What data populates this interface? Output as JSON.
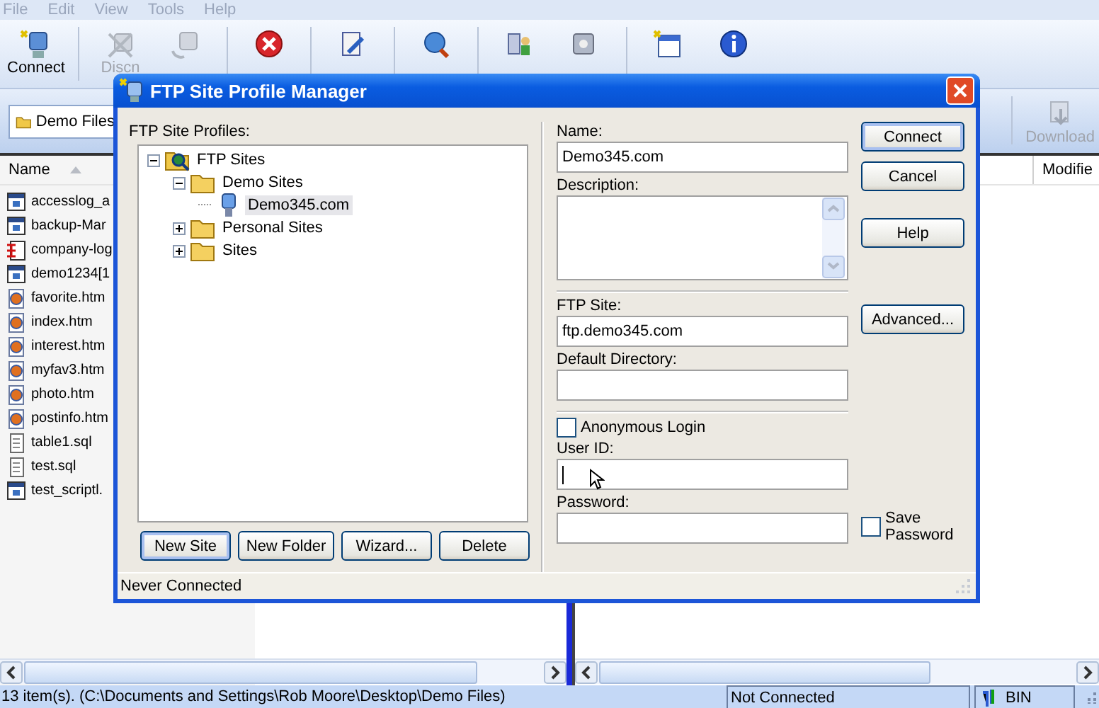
{
  "menu": [
    "File",
    "Edit",
    "View",
    "Tools",
    "Help"
  ],
  "toolbar": [
    {
      "kind": "connect",
      "label": "Connect",
      "disabled": false
    },
    {
      "kind": "disconnect",
      "label": "Discn",
      "disabled": true
    },
    {
      "kind": "reconnect",
      "disabled": true
    },
    {
      "kind": "stop",
      "disabled": false
    },
    {
      "kind": "options",
      "disabled": false
    },
    {
      "kind": "url",
      "disabled": false
    },
    {
      "kind": "kb",
      "disabled": false
    },
    {
      "kind": "support",
      "disabled": false
    },
    {
      "kind": "update",
      "disabled": false
    },
    {
      "kind": "about",
      "disabled": false
    }
  ],
  "address": {
    "folder": "Demo Files"
  },
  "remote_toolbar": [
    {
      "kind": "download",
      "label": "Download",
      "disabled": true
    }
  ],
  "local_files": {
    "column": "Name",
    "items": [
      {
        "name": "accesslog_a",
        "kind": "exe"
      },
      {
        "name": "backup-Mar",
        "kind": "exe"
      },
      {
        "name": "company-log",
        "kind": "image"
      },
      {
        "name": "demo1234[1",
        "kind": "exe"
      },
      {
        "name": "favorite.htm",
        "kind": "html"
      },
      {
        "name": "index.htm",
        "kind": "html"
      },
      {
        "name": "interest.htm",
        "kind": "html"
      },
      {
        "name": "myfav3.htm",
        "kind": "html"
      },
      {
        "name": "photo.htm",
        "kind": "html"
      },
      {
        "name": "postinfo.htm",
        "kind": "html"
      },
      {
        "name": "table1.sql",
        "kind": "text"
      },
      {
        "name": "test.sql",
        "kind": "text"
      },
      {
        "name": "test_scriptl.",
        "kind": "exe"
      }
    ]
  },
  "remote_files": {
    "column": "Modifie"
  },
  "dialog": {
    "title": "FTP Site Profile Manager",
    "profiles_label": "FTP Site Profiles:",
    "tree": [
      {
        "label": "FTP Sites",
        "kind": "root",
        "expanded": true,
        "selected": false,
        "children": [
          {
            "label": "Demo Sites",
            "kind": "folder",
            "expanded": true,
            "selected": false,
            "children": [
              {
                "label": "Demo345.com",
                "kind": "site",
                "selected": true
              }
            ]
          },
          {
            "label": "Personal Sites",
            "kind": "folder",
            "expanded": false,
            "selected": false
          },
          {
            "label": "Sites",
            "kind": "folder",
            "expanded": false,
            "selected": false
          }
        ]
      }
    ],
    "tree_buttons": [
      {
        "label": "New Site",
        "default": true
      },
      {
        "label": "New Folder",
        "default": false
      },
      {
        "label": "Wizard...",
        "default": false
      },
      {
        "label": "Delete",
        "default": false
      }
    ],
    "name": {
      "label": "Name:",
      "value": "Demo345.com"
    },
    "description": {
      "label": "Description:"
    },
    "ftp_site": {
      "label": "FTP Site:",
      "value": "ftp.demo345.com"
    },
    "default_directory": {
      "label": "Default Directory:"
    },
    "anonymous_login": {
      "label": "Anonymous Login",
      "checked": false
    },
    "user_id": {
      "label": "User ID:",
      "focused": true
    },
    "password": {
      "label": "Password:"
    },
    "save_password": {
      "label": "Save Password",
      "checked": false
    },
    "buttons": [
      {
        "label": "Connect",
        "default": true
      },
      {
        "label": "Cancel",
        "default": false
      },
      {
        "label": "Help",
        "default": false
      }
    ],
    "advanced_button": {
      "label": "Advanced...",
      "default": false
    },
    "status": "Never Connected"
  },
  "status_bar": {
    "path": "13 item(s).  (C:\\Documents and Settings\\Rob Moore\\Desktop\\Demo Files)",
    "connection": "Not Connected",
    "mode": "BIN"
  }
}
